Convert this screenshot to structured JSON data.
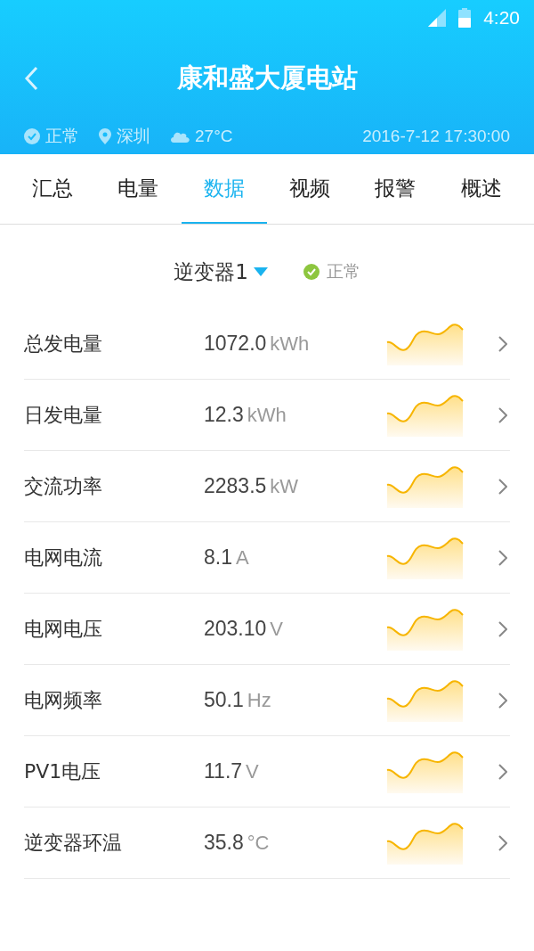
{
  "status_bar": {
    "time": "4:20"
  },
  "header": {
    "title": "康和盛大厦电站",
    "status": "正常",
    "location": "深圳",
    "weather": "27°C",
    "datetime": "2016-7-12 17:30:00"
  },
  "tabs": [
    {
      "label": "汇总",
      "selected": false
    },
    {
      "label": "电量",
      "selected": false
    },
    {
      "label": "数据",
      "selected": true
    },
    {
      "label": "视频",
      "selected": false
    },
    {
      "label": "报警",
      "selected": false
    },
    {
      "label": "概述",
      "selected": false
    }
  ],
  "device": {
    "name": "逆变器1",
    "status": "正常"
  },
  "rows": [
    {
      "label": "总发电量",
      "value": "1072.0",
      "unit": "kWh"
    },
    {
      "label": "日发电量",
      "value": "12.3",
      "unit": "kWh"
    },
    {
      "label": "交流功率",
      "value": "2283.5",
      "unit": "kW"
    },
    {
      "label": "电网电流",
      "value": "8.1",
      "unit": "A"
    },
    {
      "label": "电网电压",
      "value": "203.10",
      "unit": "V"
    },
    {
      "label": "电网频率",
      "value": "50.1",
      "unit": "Hz"
    },
    {
      "label": "PV1电压",
      "value": "11.7",
      "unit": "V"
    },
    {
      "label": "逆变器环温",
      "value": "35.8",
      "unit": "°C"
    }
  ]
}
